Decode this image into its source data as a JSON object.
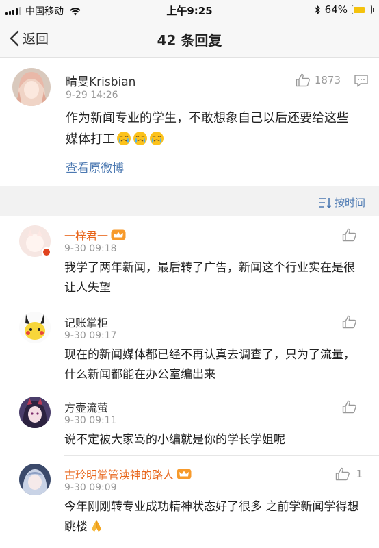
{
  "status_bar": {
    "carrier": "中国移动",
    "time": "上午9:25",
    "battery_text": "64%",
    "battery_level": 0.64,
    "battery_color": "#f4c20d"
  },
  "nav": {
    "back_label": "返回",
    "title": "42 条回复"
  },
  "post": {
    "username": "晴旻Krisbian",
    "time": "9-29 14:26",
    "like_count": "1873",
    "text": "作为新闻专业的学生，不敢想象自己以后还要给这些媒体打工",
    "emoji": [
      "crying-face-icon",
      "crying-face-icon",
      "crying-face-icon"
    ],
    "view_original": "查看原微博"
  },
  "sort": {
    "label": "按时间"
  },
  "comments": [
    {
      "name": "一梓君一",
      "vip": true,
      "time": "9-30 09:18",
      "text": "我学了两年新闻，最后转了广告，新闻这个行业实在是很让人失望",
      "likes": ""
    },
    {
      "name": "记账掌柜",
      "vip": false,
      "time": "9-30 09:17",
      "text": "现在的新闻媒体都已经不再认真去调查了，只为了流量，什么新闻都能在办公室编出来",
      "likes": ""
    },
    {
      "name": "方壶流萤",
      "vip": false,
      "time": "9-30 09:11",
      "text": "说不定被大家骂的小编就是你的学长学姐呢",
      "likes": ""
    },
    {
      "name": "古玲明掌管渎神的路人",
      "vip": true,
      "time": "9-30 09:09",
      "text": "今年刚刚转专业成功精神状态好了很多 之前学新闻学得想跳楼",
      "emoji": "folded-hands-icon",
      "likes": "1"
    }
  ],
  "colors": {
    "link": "#4c79b2",
    "vip_name": "#e8651a",
    "muted": "#999999"
  }
}
